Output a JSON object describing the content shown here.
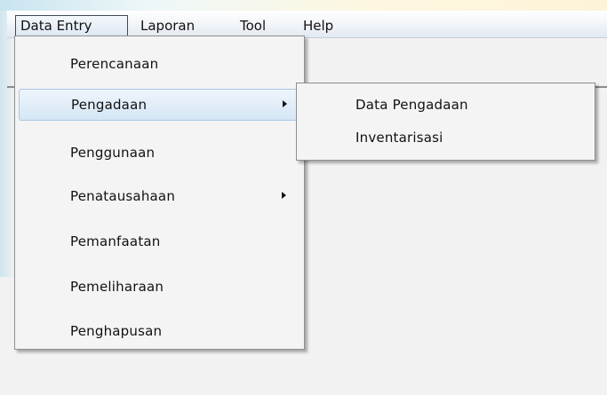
{
  "menubar": {
    "items": [
      {
        "label": "Data Entry",
        "active": true
      },
      {
        "label": "Laporan",
        "active": false
      },
      {
        "label": "Tool",
        "active": false
      },
      {
        "label": "Help",
        "active": false
      }
    ]
  },
  "dropdown": {
    "items": [
      {
        "label": "Perencanaan",
        "submenu": false,
        "highlighted": false
      },
      {
        "label": "Pengadaan",
        "submenu": true,
        "highlighted": true
      },
      {
        "label": "Penggunaan",
        "submenu": false,
        "highlighted": false
      },
      {
        "label": "Penatausahaan",
        "submenu": true,
        "highlighted": false
      },
      {
        "label": "Pemanfaatan",
        "submenu": false,
        "highlighted": false
      },
      {
        "label": "Pemeliharaan",
        "submenu": false,
        "highlighted": false
      },
      {
        "label": "Penghapusan",
        "submenu": false,
        "highlighted": false
      }
    ]
  },
  "submenu": {
    "items": [
      {
        "label": "Data Pengadaan"
      },
      {
        "label": "Inventarisasi"
      }
    ]
  },
  "colors": {
    "highlight": "#d5e6f6",
    "highlight_border": "#a9c7e6",
    "menu_bg": "#f4f4f4",
    "workspace_bg": "#f2f2f2"
  }
}
